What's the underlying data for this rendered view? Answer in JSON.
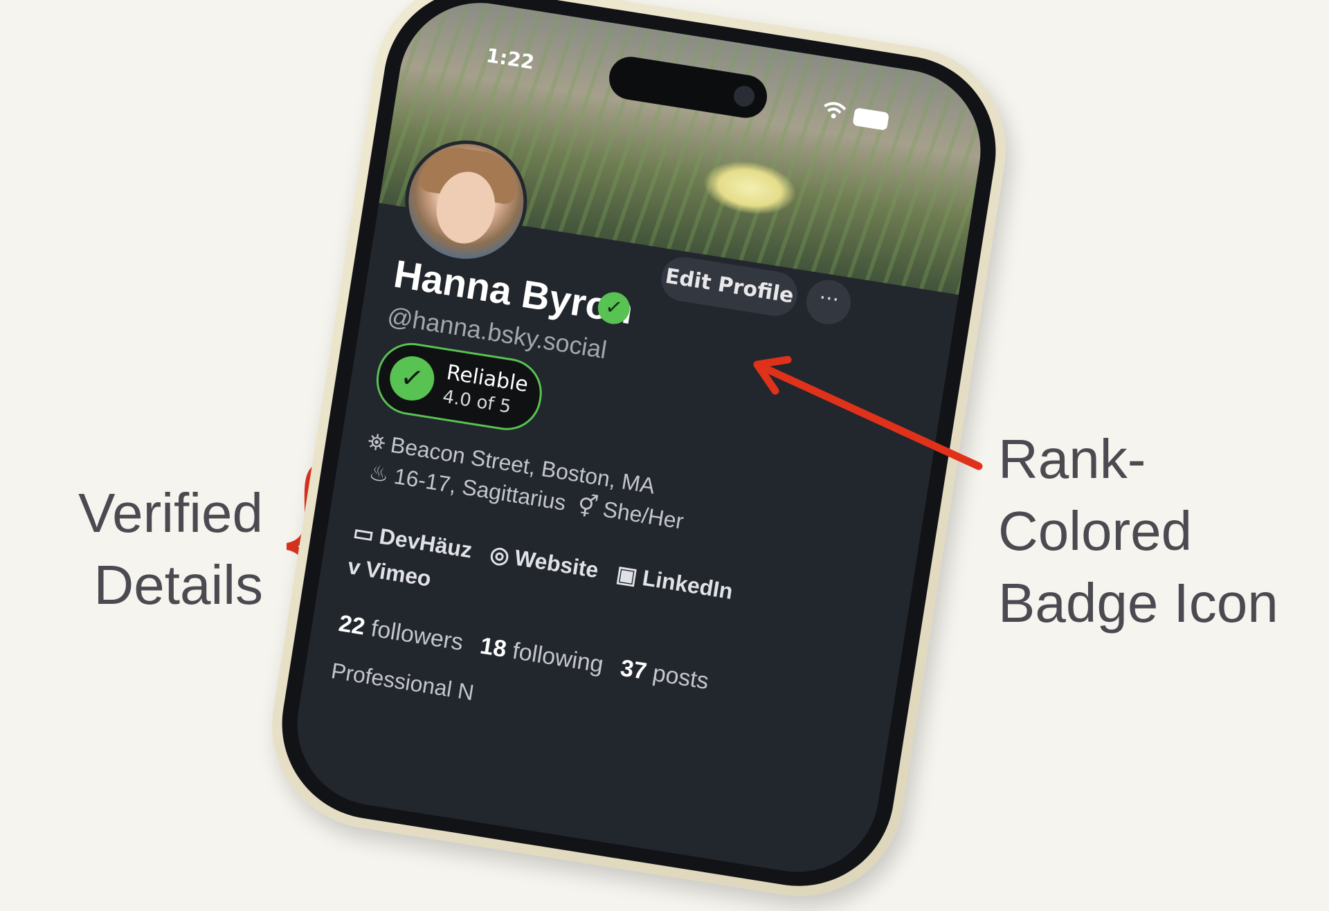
{
  "annotations": {
    "left_label_line1": "Verified",
    "left_label_line2": "Details",
    "right_label_line1": "Rank-",
    "right_label_line2": "Colored",
    "right_label_line3": "Badge Icon",
    "brace_color": "#d9321f",
    "arrow_color": "#e0321b"
  },
  "status_bar": {
    "time": "1:22",
    "wifi_icon": "wifi-icon",
    "battery_icon": "battery-icon"
  },
  "profile": {
    "display_name": "Hanna Byron",
    "handle": "@hanna.bsky.social",
    "verified_icon": "check-circle-icon",
    "accent_color": "#58c252",
    "edit_button": "Edit Profile",
    "more_button": "···",
    "reliability": {
      "title": "Reliable",
      "score": "4.0 of 5"
    },
    "details": {
      "location": "Beacon Street, Boston, MA",
      "birthday": "16-17, Sagittarius",
      "pronouns": "She/Her"
    },
    "links": [
      {
        "label": "DevHäuz",
        "icon": "laptop-code-icon"
      },
      {
        "label": "Website",
        "icon": "compass-icon"
      },
      {
        "label": "LinkedIn",
        "icon": "linkedin-icon"
      },
      {
        "label": "Vimeo",
        "icon": "vimeo-icon"
      }
    ],
    "stats": {
      "followers_count": "22",
      "followers_label": "followers",
      "following_count": "18",
      "following_label": "following",
      "posts_count": "37",
      "posts_label": "posts"
    },
    "professional_text": "Professional N"
  }
}
